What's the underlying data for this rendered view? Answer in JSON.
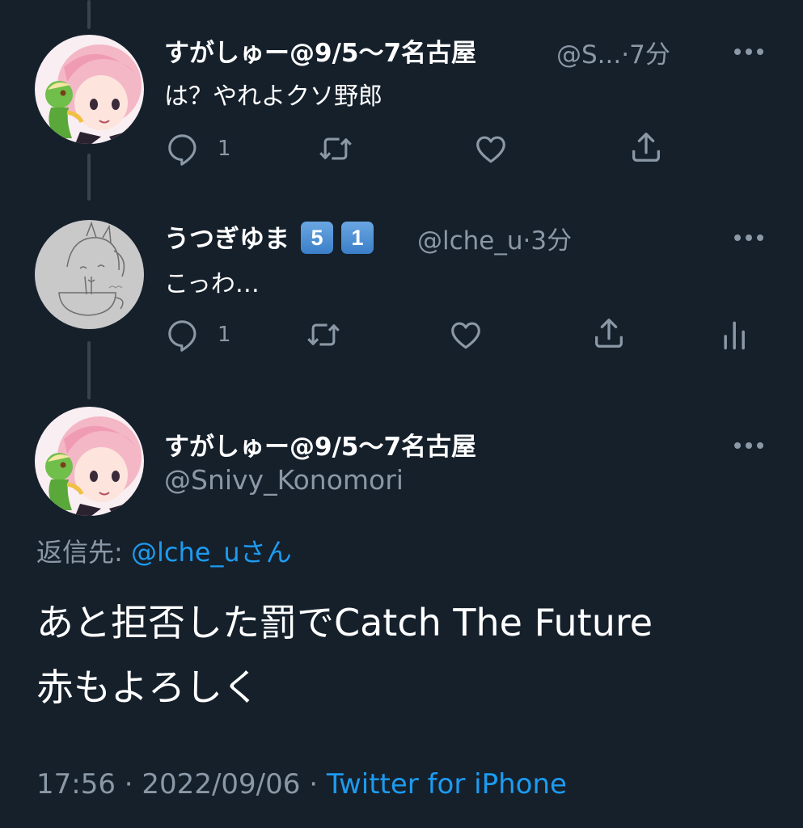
{
  "tweets": [
    {
      "name": "すがしゅー@9/5〜7名古屋",
      "handle": "@S...",
      "time_sep": "·",
      "time": "7分",
      "text": "は？やれよクソ野郎",
      "reply_count": "1",
      "avatar": "anime-girl-with-snivy"
    },
    {
      "name": "うつぎゆま",
      "badges": [
        "5",
        "1"
      ],
      "handle": "@lche_u",
      "time_sep": "·",
      "time": "3分",
      "text": "こっわ…",
      "reply_count": "1",
      "avatar": "pencil-sketch"
    }
  ],
  "main_tweet": {
    "name": "すがしゅー@9/5〜7名古屋",
    "handle": "@Snivy_Konomori",
    "reply_label": "返信先:",
    "reply_handle": "@lche_u",
    "reply_suffix": "さん",
    "text_line1": "あと拒否した罰でCatch The Future",
    "text_line2": "赤もよろしく",
    "time": "17:56",
    "sep": "·",
    "date": "2022/09/06",
    "source": "Twitter for iPhone"
  },
  "icons": [
    "reply-icon",
    "retweet-icon",
    "like-icon",
    "share-icon",
    "analytics-icon",
    "more-icon"
  ],
  "colors": {
    "background": "#15202b",
    "secondary_text": "#8b98a5",
    "link": "#1d9bf0",
    "thread_line": "#38444d"
  }
}
